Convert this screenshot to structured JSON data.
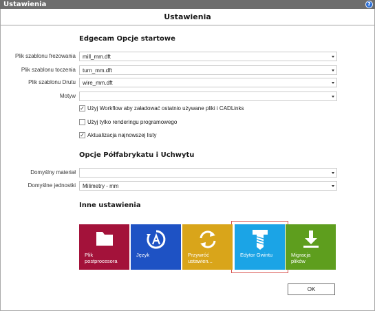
{
  "window": {
    "title": "Ustawienia",
    "help_glyph": "?"
  },
  "dialog": {
    "header": "Ustawienia"
  },
  "startup": {
    "title": "Edgecam Opcje startowe",
    "fields": [
      {
        "label": "Plik szablonu frezowania",
        "value": "mill_mm.dft"
      },
      {
        "label": "Plik szablonu toczenia",
        "value": "turn_mm.dft"
      },
      {
        "label": "Plik szablonu Drutu",
        "value": "wire_mm.dft"
      },
      {
        "label": "Motyw",
        "value": ""
      }
    ],
    "checks": [
      {
        "label": "Użyj Workflow aby załadować ostatnio używane pliki i CADLinks",
        "checked": true,
        "mark": "✓"
      },
      {
        "label": "Użyj tylko renderingu programowego",
        "checked": false,
        "mark": ""
      },
      {
        "label": "Aktualizacja najnowszej listy",
        "checked": true,
        "mark": "✓"
      }
    ]
  },
  "stock": {
    "title": "Opcje Półfabrykatu i Uchwytu",
    "fields": [
      {
        "label": "Domyślny materiał",
        "value": ""
      },
      {
        "label": "Domyślne jednostki",
        "value": "Milimetry - mm"
      }
    ]
  },
  "other": {
    "title": "Inne ustawienia",
    "tiles": [
      {
        "label": "Plik\npostprocesora",
        "icon": "folder-icon",
        "color": "#a3123a"
      },
      {
        "label": "Język",
        "icon": "language-icon",
        "color": "#1e52c4"
      },
      {
        "label": "Przywróć\nustawien...",
        "icon": "restore-icon",
        "color": "#d9a51a"
      },
      {
        "label": "Edytor Gwintu",
        "icon": "screw-icon",
        "color": "#1ba4e6"
      },
      {
        "label": "Migracja\nplików",
        "icon": "download-icon",
        "color": "#5e9e1e"
      }
    ],
    "selected_tile": 3
  },
  "buttons": {
    "ok": "OK"
  },
  "colors": {
    "titlebar": "#6d6d6d",
    "tile_postprocessor": "#a3123a",
    "tile_language": "#1e52c4",
    "tile_restore": "#d9a51a",
    "tile_thread_editor": "#1ba4e6",
    "tile_migration": "#5e9e1e",
    "selection_border": "#d9534f"
  }
}
